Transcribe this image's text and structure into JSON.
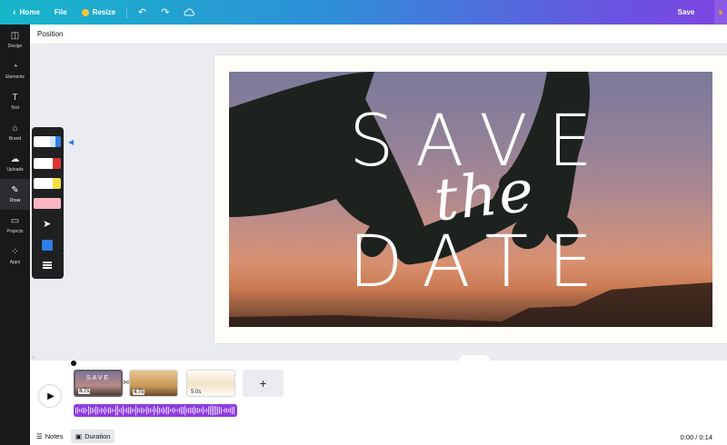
{
  "topbar": {
    "home_label": "Home",
    "file_label": "File",
    "resize_label": "Resize",
    "save_label": "Save"
  },
  "sidebar": {
    "items": [
      {
        "label": "Design",
        "icon": "layout-icon"
      },
      {
        "label": "Elements",
        "icon": "shapes-icon"
      },
      {
        "label": "Text",
        "icon": "text-icon"
      },
      {
        "label": "Brand",
        "icon": "brand-icon"
      },
      {
        "label": "Uploads",
        "icon": "cloud-upload-icon"
      },
      {
        "label": "Draw",
        "icon": "pen-icon"
      },
      {
        "label": "Projects",
        "icon": "folder-icon"
      },
      {
        "label": "Apps",
        "icon": "apps-grid-icon"
      }
    ],
    "active": "Draw"
  },
  "toolbar": {
    "position_label": "Position"
  },
  "canvas": {
    "line1": "SAVE",
    "script": "the",
    "line2": "DATE"
  },
  "draw_tools": {
    "selected_color": "#2f7fe6"
  },
  "timeline": {
    "scenes": [
      {
        "duration": "4.7s",
        "mini": "SAVE"
      },
      {
        "duration": "4.7s"
      },
      {
        "duration": "5.0s"
      }
    ],
    "add_label": "+",
    "time": "0:00 / 0:14"
  },
  "footer": {
    "notes_label": "Notes",
    "duration_label": "Duration"
  },
  "colors": {
    "accent": "#8d3ce3",
    "topbar_start": "#16b6c9",
    "topbar_end": "#7d45e2"
  }
}
